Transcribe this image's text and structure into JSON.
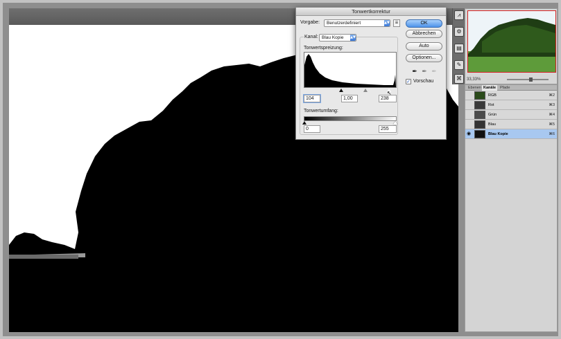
{
  "dialog": {
    "title": "Tonwertkorrektur",
    "preset_label": "Vorgabe:",
    "preset_value": "Benutzerdefiniert",
    "channel_label": "Kanal:",
    "channel_value": "Blau Kopie",
    "input_levels_label": "Tonwertspreizung:",
    "input_black": "104",
    "input_gamma": "1,00",
    "input_white": "238",
    "output_levels_label": "Tonwertumfang:",
    "output_black": "0",
    "output_white": "255",
    "buttons": {
      "ok": "OK",
      "cancel": "Abbrechen",
      "auto": "Auto",
      "options": "Optionen..."
    },
    "preview_label": "Vorschau",
    "preview_checked": true
  },
  "navigator": {
    "zoom": "33,33%"
  },
  "channels_panel": {
    "tabs": [
      "Ebenen",
      "Kanäle",
      "Pfade"
    ],
    "active_tab": "Kanäle",
    "rows": [
      {
        "name": "RGB",
        "shortcut": "⌘2",
        "visible": false,
        "selected": false
      },
      {
        "name": "Rot",
        "shortcut": "⌘3",
        "visible": false,
        "selected": false
      },
      {
        "name": "Grün",
        "shortcut": "⌘4",
        "visible": false,
        "selected": false
      },
      {
        "name": "Blau",
        "shortcut": "⌘5",
        "visible": false,
        "selected": false
      },
      {
        "name": "Blau Kopie",
        "shortcut": "⌘6",
        "visible": true,
        "selected": true
      }
    ]
  },
  "colors": {
    "selection_blue": "#a8c8f0",
    "navigator_frame": "#d32020",
    "primary_button": "#4d93ea"
  }
}
